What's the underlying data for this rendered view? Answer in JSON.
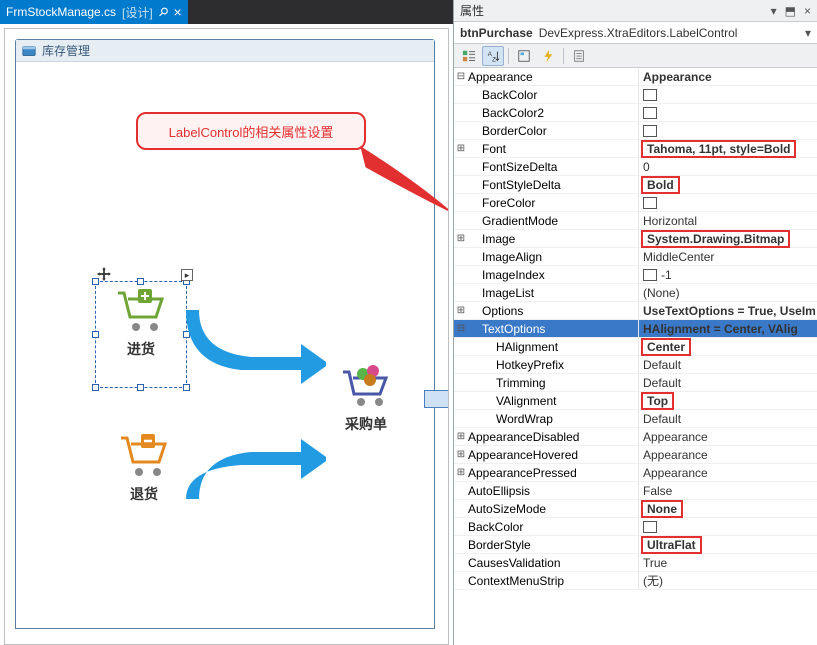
{
  "tab": {
    "filename": "FrmStockManage.cs",
    "mode": "[设计]"
  },
  "form": {
    "title": "库存管理"
  },
  "callout": {
    "text": "LabelControl的相关属性设置"
  },
  "designer": {
    "purchase": "进货",
    "return": "退货",
    "order": "采购单"
  },
  "panel": {
    "title": "属性",
    "component": "btnPurchase",
    "type": "DevExpress.XtraEditors.LabelControl"
  },
  "props": [
    {
      "name": "Appearance",
      "val": "Appearance",
      "exp": "-",
      "indent": 0,
      "boldval": true
    },
    {
      "name": "BackColor",
      "val": "",
      "indent": 1,
      "swatch": true
    },
    {
      "name": "BackColor2",
      "val": "",
      "indent": 1,
      "swatch": true
    },
    {
      "name": "BorderColor",
      "val": "",
      "indent": 1,
      "swatch": true
    },
    {
      "name": "Font",
      "val": "Tahoma, 11pt, style=Bold",
      "exp": "+",
      "indent": 1,
      "boldval": true,
      "red": true
    },
    {
      "name": "FontSizeDelta",
      "val": "0",
      "indent": 1
    },
    {
      "name": "FontStyleDelta",
      "val": "Bold",
      "indent": 1,
      "boldval": true,
      "red": true
    },
    {
      "name": "ForeColor",
      "val": "",
      "indent": 1,
      "swatch": true
    },
    {
      "name": "GradientMode",
      "val": "Horizontal",
      "indent": 1
    },
    {
      "name": "Image",
      "val": "System.Drawing.Bitmap",
      "exp": "+",
      "indent": 1,
      "boldval": true,
      "red": true
    },
    {
      "name": "ImageAlign",
      "val": "MiddleCenter",
      "indent": 1
    },
    {
      "name": "ImageIndex",
      "val": "-1",
      "indent": 1,
      "swatch": true
    },
    {
      "name": "ImageList",
      "val": "(None)",
      "indent": 1
    },
    {
      "name": "Options",
      "val": "UseTextOptions = True, UseIm",
      "exp": "+",
      "indent": 1,
      "boldval": true
    },
    {
      "name": "TextOptions",
      "val": "HAlignment = Center, VAlig",
      "exp": "-",
      "indent": 1,
      "boldval": true,
      "selected": true
    },
    {
      "name": "HAlignment",
      "val": "Center",
      "indent": 2,
      "boldval": true,
      "red": true
    },
    {
      "name": "HotkeyPrefix",
      "val": "Default",
      "indent": 2
    },
    {
      "name": "Trimming",
      "val": "Default",
      "indent": 2
    },
    {
      "name": "VAlignment",
      "val": "Top",
      "indent": 2,
      "boldval": true,
      "red": true
    },
    {
      "name": "WordWrap",
      "val": "Default",
      "indent": 2
    },
    {
      "name": "AppearanceDisabled",
      "val": "Appearance",
      "exp": "+",
      "indent": 0
    },
    {
      "name": "AppearanceHovered",
      "val": "Appearance",
      "exp": "+",
      "indent": 0
    },
    {
      "name": "AppearancePressed",
      "val": "Appearance",
      "exp": "+",
      "indent": 0
    },
    {
      "name": "AutoEllipsis",
      "val": "False",
      "indent": 0
    },
    {
      "name": "AutoSizeMode",
      "val": "None",
      "indent": 0,
      "boldval": true,
      "red": true
    },
    {
      "name": "BackColor",
      "val": "",
      "indent": 0,
      "swatch": true
    },
    {
      "name": "BorderStyle",
      "val": "UltraFlat",
      "indent": 0,
      "boldval": true,
      "red": true
    },
    {
      "name": "CausesValidation",
      "val": "True",
      "indent": 0
    },
    {
      "name": "ContextMenuStrip",
      "val": "(无)",
      "indent": 0
    }
  ]
}
